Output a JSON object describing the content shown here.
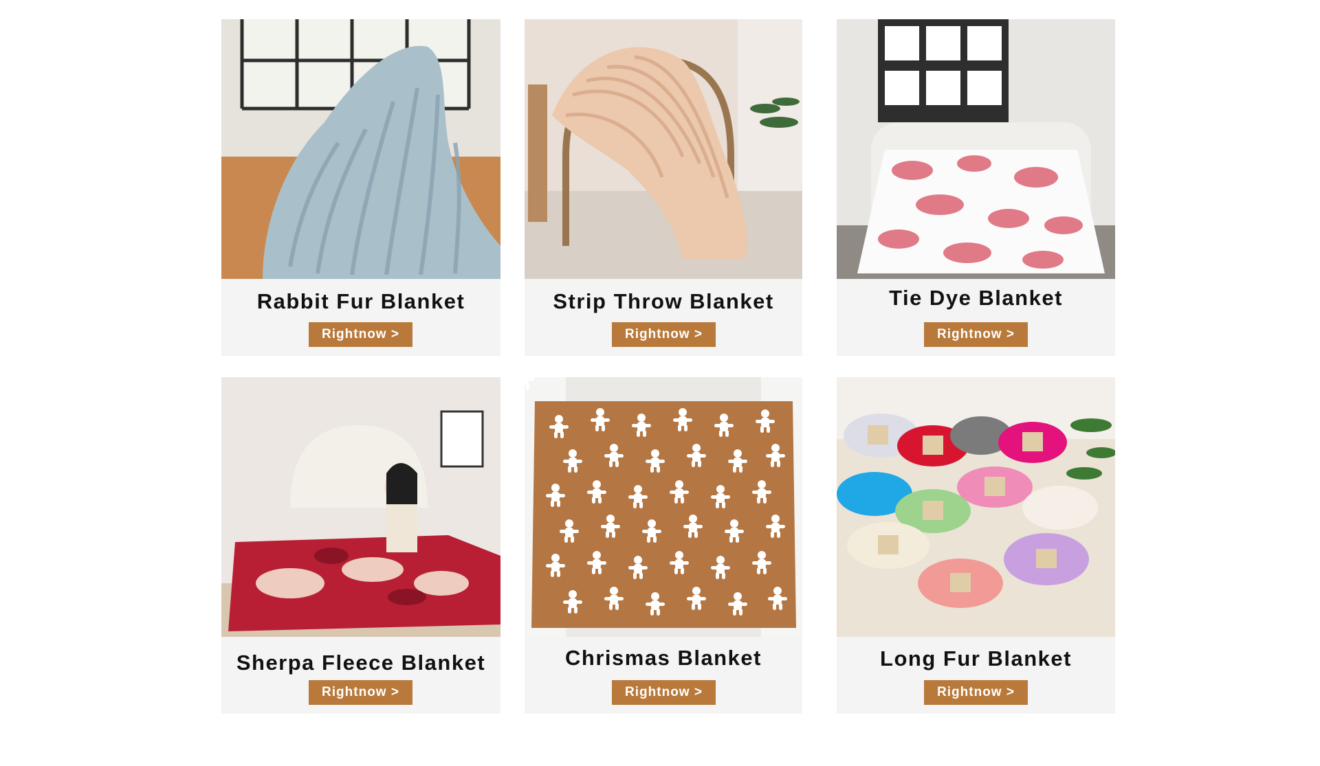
{
  "products": [
    {
      "title": "Rabbit Fur Blanket",
      "button": "Rightnow >",
      "image_icon": "blue-rabbit-fur-blanket-photo",
      "accent": "#a9bfca"
    },
    {
      "title": "Strip Throw Blanket",
      "button": "Rightnow >",
      "image_icon": "beige-strip-throw-blanket-photo",
      "accent": "#e8c9b0"
    },
    {
      "title": "Tie Dye Blanket",
      "button": "Rightnow >",
      "image_icon": "pink-tie-dye-blanket-photo",
      "accent": "#e07a86"
    },
    {
      "title": "Sherpa Fleece Blanket",
      "button": "Rightnow >",
      "image_icon": "red-sherpa-fleece-blanket-photo",
      "accent": "#b81f35"
    },
    {
      "title": "Chrismas Blanket",
      "button": "Rightnow >",
      "image_icon": "brown-gingerbread-blanket-photo",
      "accent": "#b47643"
    },
    {
      "title": "Long Fur Blanket",
      "button": "Rightnow >",
      "image_icon": "colorful-long-fur-blankets-photo",
      "accent": "#c8a0e0"
    }
  ],
  "colors": {
    "button_bg": "#b8793b",
    "card_bg": "#f4f4f4",
    "title_text": "#111111"
  }
}
